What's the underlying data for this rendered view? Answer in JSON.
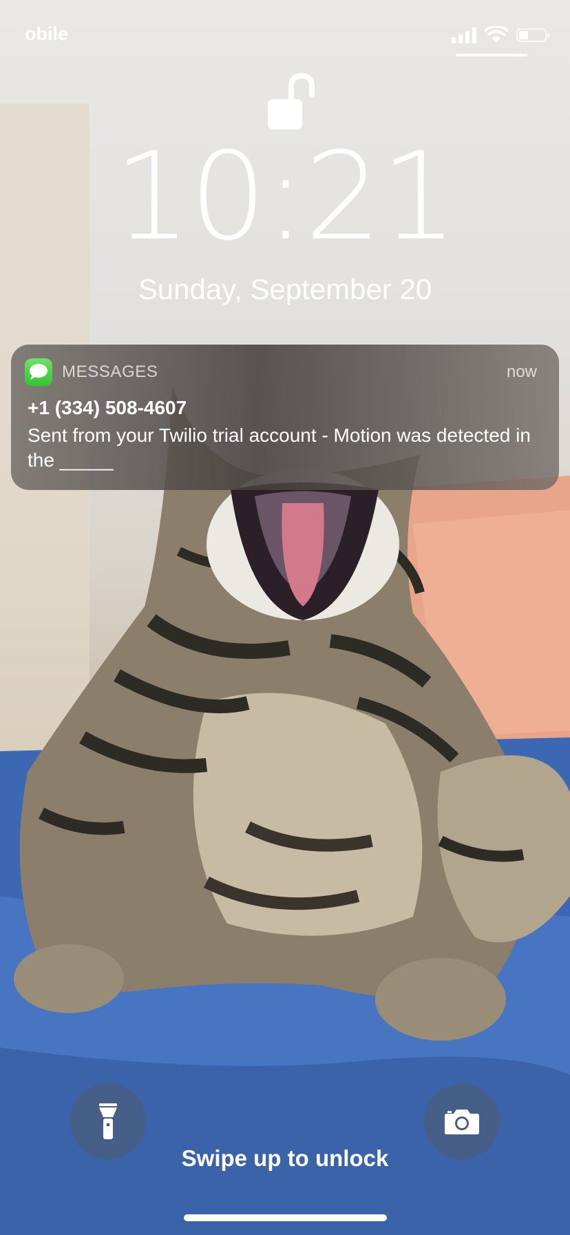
{
  "status_bar": {
    "carrier": "obile",
    "signal_icon": "cellular-signal-icon",
    "wifi_icon": "wifi-icon",
    "battery_icon": "battery-icon",
    "battery_level": 0.35
  },
  "lock_screen": {
    "lock_icon": "unlocked-padlock-icon",
    "time": "10:21",
    "date": "Sunday, September 20"
  },
  "notification": {
    "app_icon": "messages-app-icon",
    "app_name": "MESSAGES",
    "time": "now",
    "sender": "+1 (334) 508-4607",
    "body": "Sent from your Twilio trial account - Motion was detected in the _____"
  },
  "bottom": {
    "flashlight_icon": "flashlight-icon",
    "camera_icon": "camera-icon",
    "swipe_label": "Swipe up to unlock"
  },
  "colors": {
    "messages_green": "#34c52f",
    "quick_button_bg": "#485e80",
    "text": "#ffffff"
  }
}
